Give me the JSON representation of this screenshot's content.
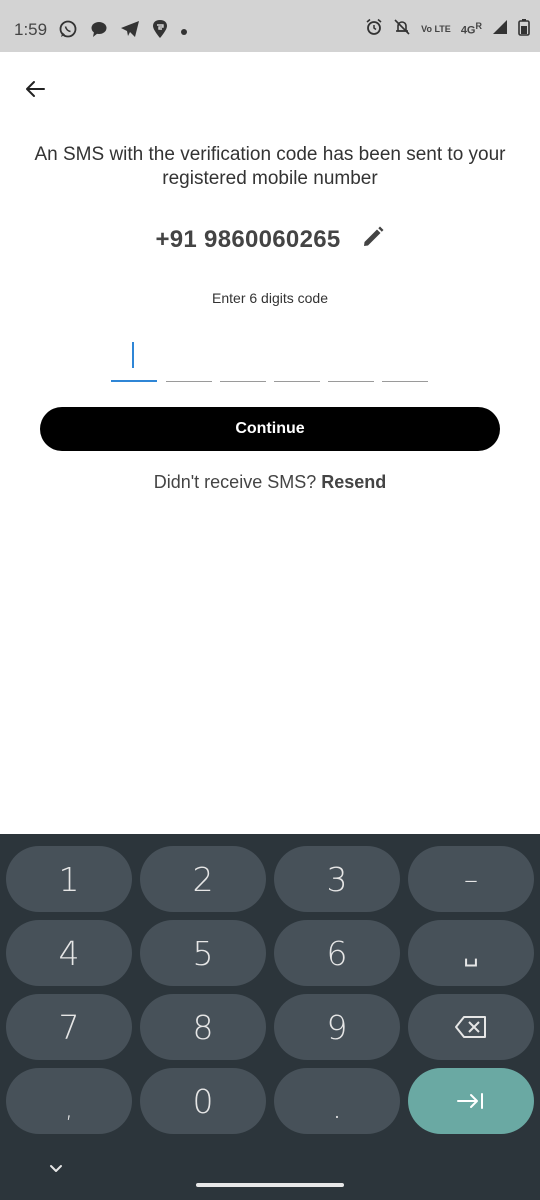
{
  "status_bar": {
    "time": "1:59",
    "volte_label": "Vo LTE",
    "network_label": "4G",
    "roaming_label": "R",
    "left_icons": [
      "whatsapp-icon",
      "chat-bubble-icon",
      "telegram-icon",
      "swiggy-icon",
      "dot-icon"
    ],
    "right_icons": [
      "alarm-icon",
      "bell-off-icon",
      "volte-icon",
      "signal-icon",
      "battery-icon"
    ]
  },
  "header": {
    "back_icon": "arrow-left-icon"
  },
  "verification": {
    "info_text": "An SMS with the verification code has been sent to your registered mobile number",
    "phone_number": "+91 9860060265",
    "edit_icon": "pencil-icon",
    "code_label": "Enter 6 digits code",
    "code_digits": [
      "",
      "",
      "",
      "",
      "",
      ""
    ],
    "active_index": 0
  },
  "actions": {
    "continue_label": "Continue",
    "resend_prompt": "Didn't receive SMS?",
    "resend_link": "Resend"
  },
  "keyboard": {
    "keys": [
      "1",
      "2",
      "3",
      "–",
      "4",
      "5",
      "6",
      "␣",
      "7",
      "8",
      "9",
      ",",
      "0",
      "."
    ],
    "accent": "#6aa9a3"
  }
}
